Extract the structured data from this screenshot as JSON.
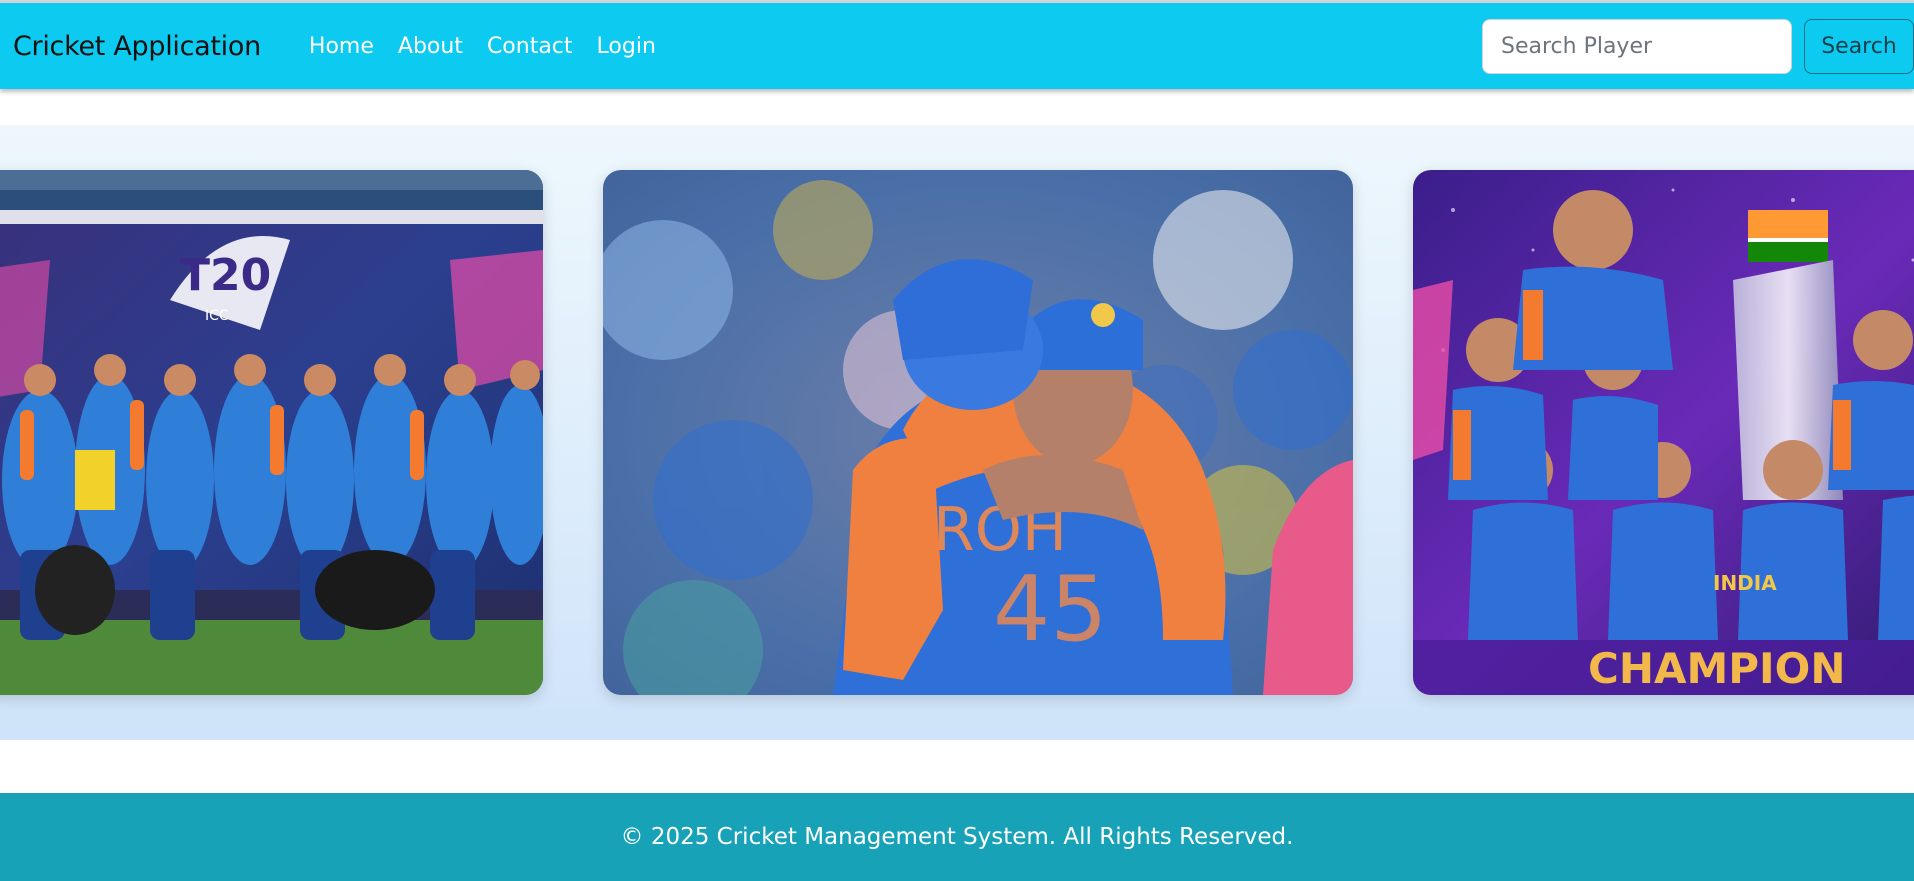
{
  "navbar": {
    "brand": "Cricket Application",
    "links": [
      {
        "label": "Home"
      },
      {
        "label": "About"
      },
      {
        "label": "Contact"
      },
      {
        "label": "Login"
      }
    ],
    "search": {
      "placeholder": "Search Player",
      "value": "",
      "button_label": "Search"
    },
    "background_color": "#0dcaf0"
  },
  "carousel": {
    "slides": [
      {
        "alt": "team celebration photo",
        "image_text": [
          "T20",
          "ICC"
        ]
      },
      {
        "alt": "players embracing photo",
        "image_text": [
          "ROH",
          "45"
        ]
      },
      {
        "alt": "champions poster",
        "image_text": [
          "INDIA",
          "CHAMPION"
        ]
      }
    ]
  },
  "footer": {
    "text": "© 2025 Cricket Management System. All Rights Reserved.",
    "background_color": "#17a2b8"
  }
}
